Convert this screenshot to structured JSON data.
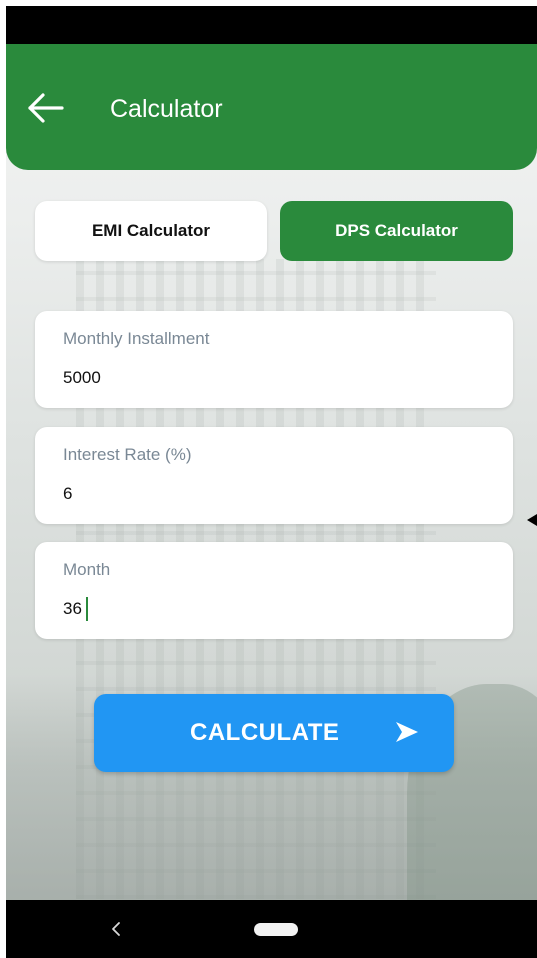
{
  "app_bar": {
    "title": "Calculator",
    "back_icon": "arrow-left-icon",
    "color": "#2a8a3c"
  },
  "tabs": [
    {
      "label": "EMI Calculator",
      "selected": false
    },
    {
      "label": "DPS Calculator",
      "selected": true
    }
  ],
  "form": {
    "monthly_installment": {
      "label": "Monthly Installment",
      "value": "5000"
    },
    "interest_rate": {
      "label": "Interest Rate (%)",
      "value": "6"
    },
    "month": {
      "label": "Month",
      "value": "36"
    }
  },
  "calculate_button": {
    "label": "CALCULATE",
    "icon": "send-arrow-icon",
    "color": "#2196f3"
  },
  "nav_bar": {
    "back_icon": "nav-back-icon",
    "home_icon": "nav-home-pill-icon"
  }
}
